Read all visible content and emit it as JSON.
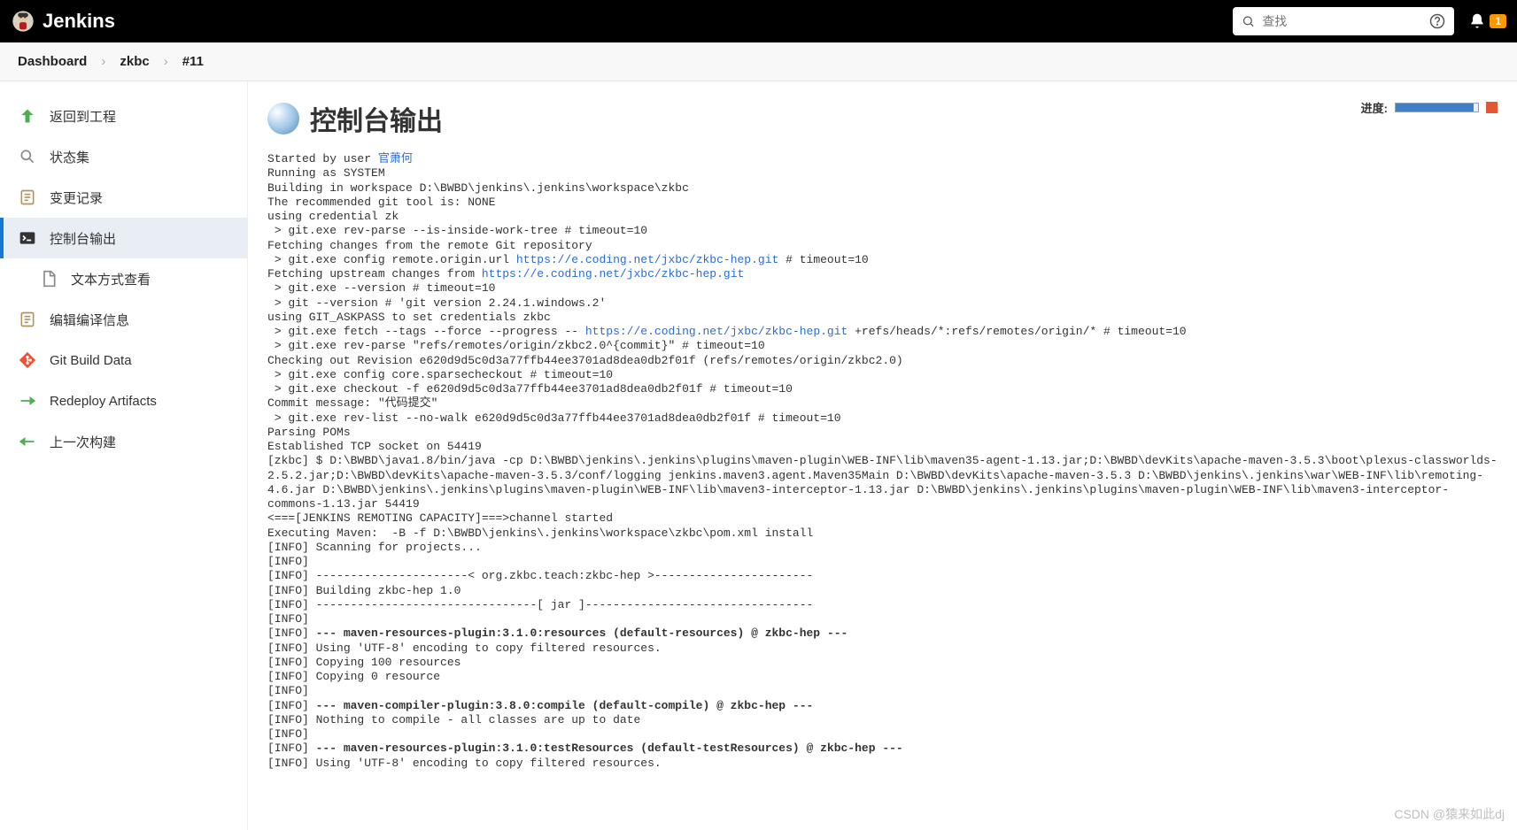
{
  "header": {
    "logoText": "Jenkins",
    "searchPlaceholder": "查找",
    "notificationCount": "1"
  },
  "breadcrumbs": [
    {
      "label": "Dashboard"
    },
    {
      "label": "zkbc"
    },
    {
      "label": "#11"
    }
  ],
  "sidebar": [
    {
      "id": "back-to-project",
      "label": "返回到工程",
      "icon": "arrow-up",
      "color": "#4caf50"
    },
    {
      "id": "status",
      "label": "状态集",
      "icon": "magnifier",
      "color": "#888"
    },
    {
      "id": "changes",
      "label": "变更记录",
      "icon": "notepad",
      "color": "#b4945e"
    },
    {
      "id": "console",
      "label": "控制台输出",
      "icon": "terminal",
      "color": "#333",
      "active": true
    },
    {
      "id": "console-text",
      "label": "文本方式查看",
      "icon": "document",
      "color": "#888",
      "sub": true
    },
    {
      "id": "edit-build",
      "label": "编辑编译信息",
      "icon": "notepad",
      "color": "#b4945e"
    },
    {
      "id": "git-build-data",
      "label": "Git Build Data",
      "icon": "git",
      "color": "#f05133"
    },
    {
      "id": "redeploy",
      "label": "Redeploy Artifacts",
      "icon": "arrow-right",
      "color": "#4caf50"
    },
    {
      "id": "previous-build",
      "label": "上一次构建",
      "icon": "arrow-left",
      "color": "#4caf50"
    }
  ],
  "page": {
    "title": "控制台输出",
    "progressLabel": "进度:"
  },
  "console": {
    "startedBy": "Started by user ",
    "user": "官萧何",
    "l02": "Running as SYSTEM",
    "l03": "Building in workspace D:\\BWBD\\jenkins\\.jenkins\\workspace\\zkbc",
    "l04": "The recommended git tool is: NONE",
    "l05": "using credential zk",
    "l06": " > git.exe rev-parse --is-inside-work-tree # timeout=10",
    "l07": "Fetching changes from the remote Git repository",
    "l08a": " > git.exe config remote.origin.url ",
    "url1": "https://e.coding.net/jxbc/zkbc-hep.git",
    "l08b": " # timeout=10",
    "l09": "Fetching upstream changes from ",
    "l10": " > git.exe --version # timeout=10",
    "l11": " > git --version # 'git version 2.24.1.windows.2'",
    "l12": "using GIT_ASKPASS to set credentials zkbc",
    "l13a": " > git.exe fetch --tags --force --progress -- ",
    "l13b": " +refs/heads/*:refs/remotes/origin/* # timeout=10",
    "l14": " > git.exe rev-parse \"refs/remotes/origin/zkbc2.0^{commit}\" # timeout=10",
    "l15": "Checking out Revision e620d9d5c0d3a77ffb44ee3701ad8dea0db2f01f (refs/remotes/origin/zkbc2.0)",
    "l16": " > git.exe config core.sparsecheckout # timeout=10",
    "l17": " > git.exe checkout -f e620d9d5c0d3a77ffb44ee3701ad8dea0db2f01f # timeout=10",
    "l18": "Commit message: \"代码提交\"",
    "l19": " > git.exe rev-list --no-walk e620d9d5c0d3a77ffb44ee3701ad8dea0db2f01f # timeout=10",
    "l20": "Parsing POMs",
    "l21": "Established TCP socket on 54419",
    "l22": "[zkbc] $ D:\\BWBD\\java1.8/bin/java -cp D:\\BWBD\\jenkins\\.jenkins\\plugins\\maven-plugin\\WEB-INF\\lib\\maven35-agent-1.13.jar;D:\\BWBD\\devKits\\apache-maven-3.5.3\\boot\\plexus-classworlds-2.5.2.jar;D:\\BWBD\\devKits\\apache-maven-3.5.3/conf/logging jenkins.maven3.agent.Maven35Main D:\\BWBD\\devKits\\apache-maven-3.5.3 D:\\BWBD\\jenkins\\.jenkins\\war\\WEB-INF\\lib\\remoting-4.6.jar D:\\BWBD\\jenkins\\.jenkins\\plugins\\maven-plugin\\WEB-INF\\lib\\maven3-interceptor-1.13.jar D:\\BWBD\\jenkins\\.jenkins\\plugins\\maven-plugin\\WEB-INF\\lib\\maven3-interceptor-commons-1.13.jar 54419",
    "l23": "<===[JENKINS REMOTING CAPACITY]===>channel started",
    "l24": "Executing Maven:  -B -f D:\\BWBD\\jenkins\\.jenkins\\workspace\\zkbc\\pom.xml install",
    "l25": "[INFO] Scanning for projects...",
    "l26": "[INFO] ",
    "l27": "[INFO] ----------------------< org.zkbc.teach:zkbc-hep >-----------------------",
    "l28": "[INFO] Building zkbc-hep 1.0",
    "l29": "[INFO] --------------------------------[ jar ]---------------------------------",
    "l30": "[INFO] ",
    "l31a": "[INFO] ",
    "l31b": "--- maven-resources-plugin:3.1.0:resources (default-resources) @ zkbc-hep ---",
    "l32": "[INFO] Using 'UTF-8' encoding to copy filtered resources.",
    "l33": "[INFO] Copying 100 resources",
    "l34": "[INFO] Copying 0 resource",
    "l35": "[INFO] ",
    "l36a": "[INFO] ",
    "l36b": "--- maven-compiler-plugin:3.8.0:compile (default-compile) @ zkbc-hep ---",
    "l37": "[INFO] Nothing to compile - all classes are up to date",
    "l38": "[INFO] ",
    "l39a": "[INFO] ",
    "l39b": "--- maven-resources-plugin:3.1.0:testResources (default-testResources) @ zkbc-hep ---",
    "l40": "[INFO] Using 'UTF-8' encoding to copy filtered resources."
  },
  "watermark": "CSDN @猿来如此dj"
}
